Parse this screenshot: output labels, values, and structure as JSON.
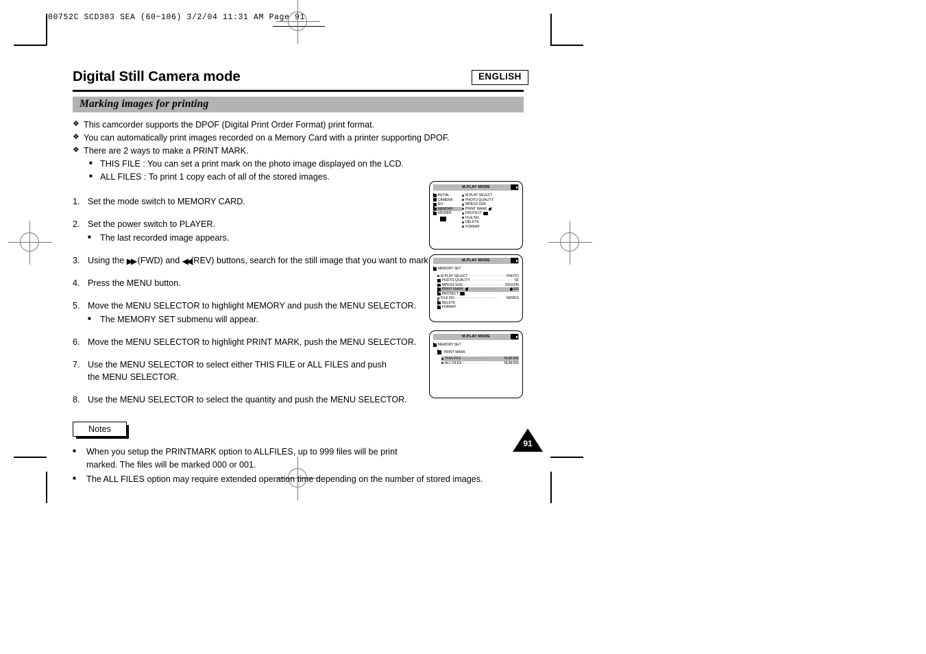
{
  "prepress": {
    "slug": "00752C SCD303 SEA (60~106)   3/2/04 11:31 AM   Page 91"
  },
  "header": {
    "language_badge": "ENGLISH",
    "page_title": "Digital Still Camera mode",
    "section_title": "Marking images for printing"
  },
  "intro_bullets": [
    {
      "marker": "❖",
      "text": "This camcorder supports the DPOF (Digital Print Order Format) print format.",
      "level": 1
    },
    {
      "marker": "❖",
      "text": "You can automatically print images recorded on a Memory Card with a printer supporting DPOF.",
      "level": 1
    },
    {
      "marker": "❖",
      "text": "There are 2 ways to make a PRINT MARK.",
      "level": 1
    },
    {
      "marker": "■",
      "text": "THIS FILE : You can set a print mark on the photo image displayed on the LCD.",
      "level": 2
    },
    {
      "marker": "■",
      "text": "ALL FILES : To print 1 copy each of all of the stored images.",
      "level": 2
    }
  ],
  "steps": [
    {
      "num": "1.",
      "text": "Set the mode switch to MEMORY CARD.",
      "sub": null
    },
    {
      "num": "2.",
      "text": "Set the power switch to PLAYER.",
      "sub": "The last recorded image appears."
    },
    {
      "num": "3.",
      "text_before": "Using the ",
      "fwd_icon": "▶▶",
      "text_mid": " (FWD) and ",
      "rev_icon": "◀◀",
      "text_after": "(REV) buttons, search for the still image that you want to mark.",
      "sub": null
    },
    {
      "num": "4.",
      "text": "Press the MENU button.",
      "sub": null
    },
    {
      "num": "5.",
      "text": "Move the MENU SELECTOR to highlight MEMORY and push the MENU SELECTOR.",
      "sub": "The MEMORY SET submenu will appear."
    },
    {
      "num": "6.",
      "text": "Move the MENU SELECTOR to highlight PRINT MARK, push the MENU SELECTOR.",
      "sub": null
    },
    {
      "num": "7.",
      "text": "Use the MENU SELECTOR to select either THIS FILE or ALL FILES and push the MENU SELECTOR.",
      "sub": null
    },
    {
      "num": "8.",
      "text": "Use the MENU SELECTOR to select the quantity and push the MENU SELECTOR.",
      "sub": null
    }
  ],
  "notes": {
    "tab_label": "Notes",
    "items": [
      {
        "marker": "■",
        "text": "When you setup the PRINTMARK option to ALLFILES, up to 999 files will be print marked. The files will be marked 000 or 001."
      },
      {
        "marker": "■",
        "text": "The ALL FILES option may require extended operation time depending on the number of stored images."
      }
    ]
  },
  "page_number": "91",
  "lcd_panels": [
    {
      "id": "panel-main-menu",
      "title": "M.PLAY MODE",
      "left_column": [
        {
          "label": "INITIAL",
          "selected": false
        },
        {
          "label": "CAMERA",
          "selected": false
        },
        {
          "label": "A/V",
          "selected": false
        },
        {
          "label": "MEMORY",
          "selected": true
        },
        {
          "label": "VIEWER",
          "selected": false
        }
      ],
      "right_column": [
        {
          "label": "M.PLAY SELECT",
          "icon": ""
        },
        {
          "label": "PHOTO QUALITY",
          "icon": ""
        },
        {
          "label": "MPEG4 SIZE",
          "icon": ""
        },
        {
          "label": "PRINT MARK",
          "icon": "print-mark-icon"
        },
        {
          "label": "PROTECT",
          "icon": "lock-icon"
        },
        {
          "label": "FILE NO.",
          "icon": ""
        },
        {
          "label": "DELETE",
          "icon": ""
        },
        {
          "label": "FORMAT",
          "icon": ""
        }
      ]
    },
    {
      "id": "panel-memory-set",
      "title": "M.PLAY MODE",
      "breadcrumb": "MEMORY SET",
      "rows": [
        {
          "label": "M.PLAY SELECT",
          "value": "PHOTO",
          "selected": false,
          "icon": ""
        },
        {
          "label": "PHOTO QUALITY",
          "value": "SF",
          "selected": false,
          "icon": ""
        },
        {
          "label": "MPEG4 SIZE",
          "value": "320X240",
          "selected": false,
          "icon": ""
        },
        {
          "label": "PRINT MARK",
          "value": "000",
          "selected": true,
          "icon": "print-mark-icon"
        },
        {
          "label": "PROTECT",
          "value": "",
          "selected": false,
          "icon": "lock-icon"
        },
        {
          "label": "FILE NO.",
          "value": "SERIES",
          "selected": false,
          "icon": ""
        },
        {
          "label": "DELETE",
          "value": "",
          "selected": false,
          "icon": ""
        },
        {
          "label": "FORMAT",
          "value": "",
          "selected": false,
          "icon": ""
        }
      ]
    },
    {
      "id": "panel-print-mark",
      "title": "M.PLAY MODE",
      "breadcrumb": "MEMORY SET",
      "submenu": "PRINT MARK",
      "rows": [
        {
          "label": "THIS FILE",
          "value": "NUM:000",
          "selected": true
        },
        {
          "label": "ALL FILES",
          "value": "NUM:000",
          "selected": false
        }
      ]
    }
  ],
  "colors": {
    "band_gray": "#b3b3b3",
    "lcd_highlight": "#b8b8b8",
    "ink": "#000000"
  }
}
